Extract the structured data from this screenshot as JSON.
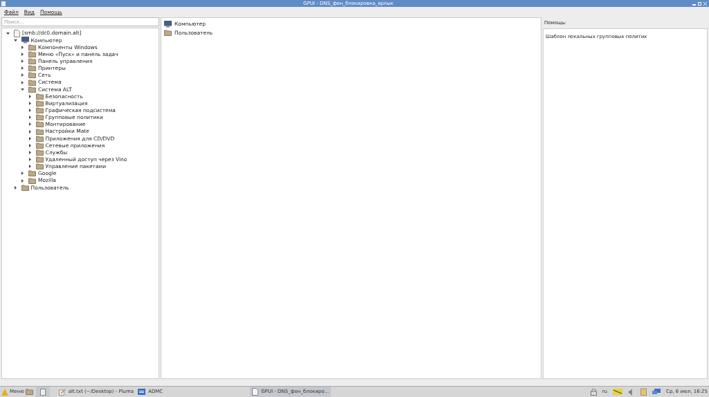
{
  "window": {
    "title": "GPUI - DNS_фон_блокировка_ярлык"
  },
  "menu": [
    "Файл",
    "Вид",
    "Помощь"
  ],
  "search": {
    "placeholder": "Поиск..."
  },
  "tree": [
    {
      "label": "[smb://dc0.domain.alt]",
      "kind": "document",
      "expanded": true,
      "children": [
        {
          "label": "Компьютер",
          "kind": "computer",
          "expanded": true,
          "children": [
            {
              "label": "Компоненты Windows",
              "kind": "folder",
              "expanded": false
            },
            {
              "label": "Меню «Пуск» и панель задач",
              "kind": "folder",
              "expanded": false
            },
            {
              "label": "Панель управления",
              "kind": "folder",
              "expanded": false
            },
            {
              "label": "Принтеры",
              "kind": "folder",
              "expanded": false
            },
            {
              "label": "Сеть",
              "kind": "folder",
              "expanded": false
            },
            {
              "label": "Система",
              "kind": "folder",
              "expanded": false
            },
            {
              "label": "Система ALT",
              "kind": "folder",
              "expanded": true,
              "children": [
                {
                  "label": "Безопасность",
                  "kind": "folder",
                  "expanded": false
                },
                {
                  "label": "Виртуализация",
                  "kind": "folder",
                  "expanded": false
                },
                {
                  "label": "Графическая подсистема",
                  "kind": "folder",
                  "expanded": false
                },
                {
                  "label": "Групповые политики",
                  "kind": "folder",
                  "expanded": false
                },
                {
                  "label": "Монтирование",
                  "kind": "folder",
                  "expanded": false
                },
                {
                  "label": "Настройки Mate",
                  "kind": "folder",
                  "expanded": false
                },
                {
                  "label": "Приложения для CD/DVD",
                  "kind": "folder",
                  "expanded": false
                },
                {
                  "label": "Сетевые приложения",
                  "kind": "folder",
                  "expanded": false
                },
                {
                  "label": "Службы",
                  "kind": "folder",
                  "expanded": false
                },
                {
                  "label": "Удаленный доступ через Vino",
                  "kind": "folder",
                  "expanded": false
                },
                {
                  "label": "Управление пакетами",
                  "kind": "folder",
                  "expanded": false
                }
              ]
            },
            {
              "label": "Google",
              "kind": "folder",
              "expanded": false
            },
            {
              "label": "Mozilla",
              "kind": "folder",
              "expanded": false
            }
          ]
        },
        {
          "label": "Пользователь",
          "kind": "folder",
          "expanded": false
        }
      ]
    }
  ],
  "content_items": [
    {
      "label": "Компьютер",
      "kind": "computer"
    },
    {
      "label": "Пользователь",
      "kind": "folder"
    }
  ],
  "help": {
    "label": "Помощь:",
    "text": "Шаблон локальных групповых политик"
  },
  "taskbar": {
    "menu_label": "Меню",
    "windows": [
      {
        "label": "alt.txt (~/Desktop) - Pluma",
        "kind": "editor",
        "selected": false
      },
      {
        "label": "ADMC",
        "kind": "admc",
        "selected": false
      },
      {
        "label": "GPUI - DNS_фон_блокиро...",
        "kind": "gpui",
        "selected": true
      }
    ],
    "layout": "ru",
    "clock": "Ср, 6 июл, 16:25"
  }
}
